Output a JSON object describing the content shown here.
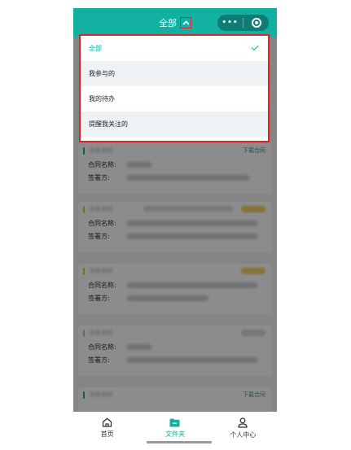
{
  "header": {
    "title": "全部",
    "toggle_icon": "chevron-up-icon",
    "more_icon": "more-dots-icon",
    "close_icon": "target-circle-icon",
    "bg_color": "#12b0a0"
  },
  "dropdown": {
    "items": [
      {
        "label": "全部",
        "selected": true
      },
      {
        "label": "我参与的",
        "selected": false
      },
      {
        "label": "我的待办",
        "selected": false
      },
      {
        "label": "提醒我关注的",
        "selected": false
      }
    ]
  },
  "cards": [
    {
      "type": "企业合同",
      "link": "下载合同",
      "bar_color": "#12b0a0",
      "name_label": "合同名称:",
      "signer_label": "签署方:"
    },
    {
      "type": "企业合同",
      "link": "",
      "bar_color": "#f0c400",
      "name_label": "合同名称:",
      "signer_label": "签署方:"
    },
    {
      "type": "企业合同",
      "link": "",
      "bar_color": "#f0c400",
      "name_label": "合同名称:",
      "signer_label": "签署方:"
    },
    {
      "type": "企业合同",
      "link": "",
      "bar_color": "#b7bbbf",
      "name_label": "合同名称:",
      "signer_label": "签署方:"
    },
    {
      "type": "企业合同",
      "link": "下载合同",
      "bar_color": "#12b0a0",
      "name_label": "",
      "signer_label": ""
    }
  ],
  "tabbar": {
    "tabs": [
      {
        "label": "首页",
        "icon": "home-icon",
        "active": false
      },
      {
        "label": "文件夹",
        "icon": "folder-icon",
        "active": true
      },
      {
        "label": "个人中心",
        "icon": "user-icon",
        "active": false
      }
    ]
  }
}
